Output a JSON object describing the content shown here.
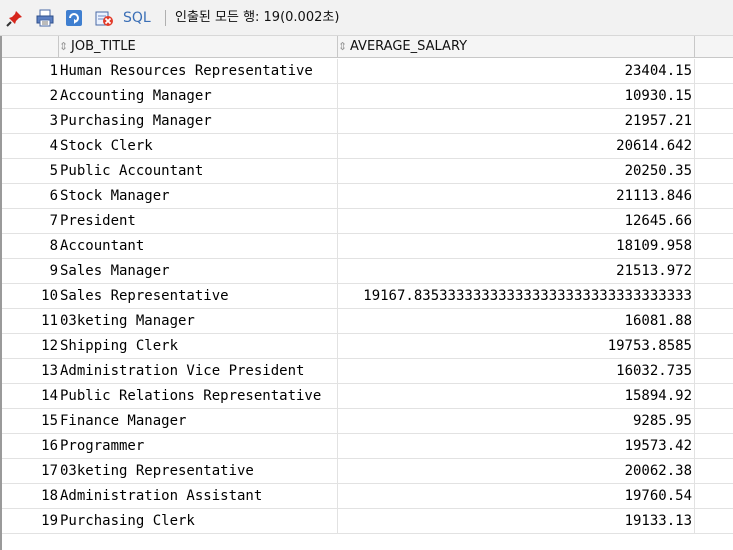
{
  "toolbar": {
    "icons": [
      "pin-icon",
      "print-icon",
      "refresh-icon",
      "cancel-icon"
    ],
    "sql_label": "SQL",
    "status_text": "인출된 모든 행: 19(0.002초)"
  },
  "grid": {
    "columns": [
      {
        "label": "JOB_TITLE"
      },
      {
        "label": "AVERAGE_SALARY"
      }
    ],
    "rows": [
      {
        "n": "1",
        "job_title": "Human Resources Representative",
        "average_salary": "23404.15"
      },
      {
        "n": "2",
        "job_title": "Accounting Manager",
        "average_salary": "10930.15"
      },
      {
        "n": "3",
        "job_title": "Purchasing Manager",
        "average_salary": "21957.21"
      },
      {
        "n": "4",
        "job_title": "Stock Clerk",
        "average_salary": "20614.642"
      },
      {
        "n": "5",
        "job_title": "Public Accountant",
        "average_salary": "20250.35"
      },
      {
        "n": "6",
        "job_title": "Stock Manager",
        "average_salary": "21113.846"
      },
      {
        "n": "7",
        "job_title": "President",
        "average_salary": "12645.66"
      },
      {
        "n": "8",
        "job_title": "Accountant",
        "average_salary": "18109.958"
      },
      {
        "n": "9",
        "job_title": "Sales Manager",
        "average_salary": "21513.972"
      },
      {
        "n": "10",
        "job_title": "Sales Representative",
        "average_salary": "19167.835333333333333333333333333333333"
      },
      {
        "n": "11",
        "job_title": "03keting Manager",
        "average_salary": "16081.88"
      },
      {
        "n": "12",
        "job_title": "Shipping Clerk",
        "average_salary": "19753.8585"
      },
      {
        "n": "13",
        "job_title": "Administration Vice President",
        "average_salary": "16032.735"
      },
      {
        "n": "14",
        "job_title": "Public Relations Representative",
        "average_salary": "15894.92"
      },
      {
        "n": "15",
        "job_title": "Finance Manager",
        "average_salary": "9285.95"
      },
      {
        "n": "16",
        "job_title": "Programmer",
        "average_salary": "19573.42"
      },
      {
        "n": "17",
        "job_title": "03keting Representative",
        "average_salary": "20062.38"
      },
      {
        "n": "18",
        "job_title": "Administration Assistant",
        "average_salary": "19760.54"
      },
      {
        "n": "19",
        "job_title": "Purchasing Clerk",
        "average_salary": "19133.13"
      }
    ]
  }
}
